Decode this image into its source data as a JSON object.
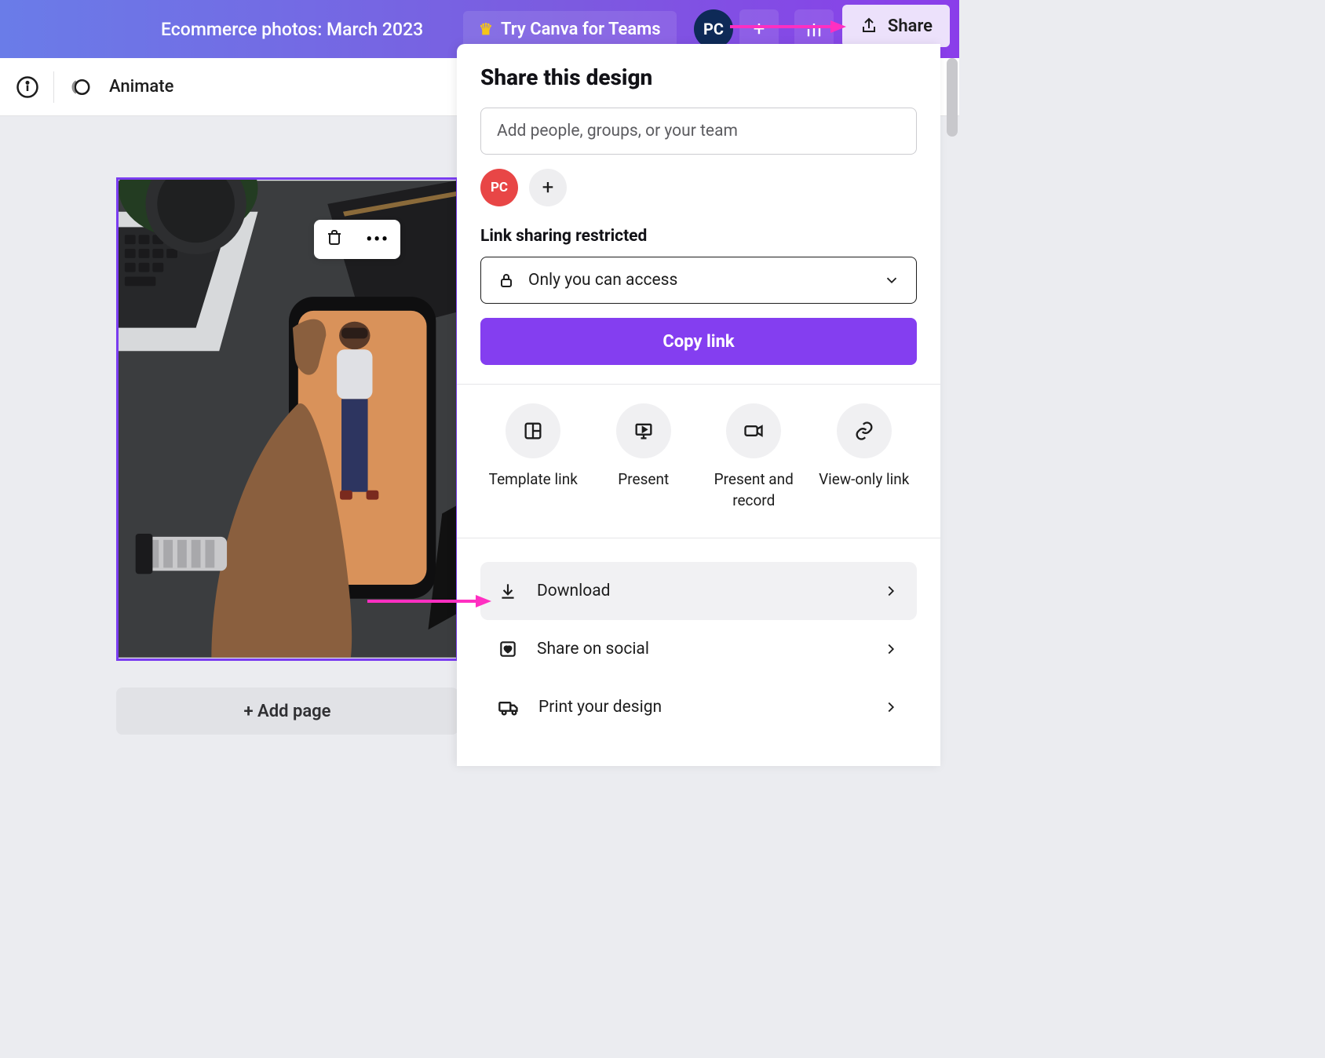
{
  "header": {
    "doc_title": "Ecommerce photos: March 2023",
    "teams_label": "Try Canva for Teams",
    "avatar_initials": "PC",
    "share_label": "Share"
  },
  "toolbar": {
    "animate_label": "Animate"
  },
  "canvas": {
    "add_page_label": "+ Add page"
  },
  "share_panel": {
    "title": "Share this design",
    "people_placeholder": "Add people, groups, or your team",
    "owner_initials": "PC",
    "link_section_label": "Link sharing restricted",
    "access_value": "Only you can access",
    "copy_link_label": "Copy link",
    "actions": [
      {
        "label": "Template link"
      },
      {
        "label": "Present"
      },
      {
        "label": "Present and record"
      },
      {
        "label": "View-only link"
      }
    ],
    "rows": {
      "download": "Download",
      "social": "Share on social",
      "print": "Print your design"
    }
  }
}
